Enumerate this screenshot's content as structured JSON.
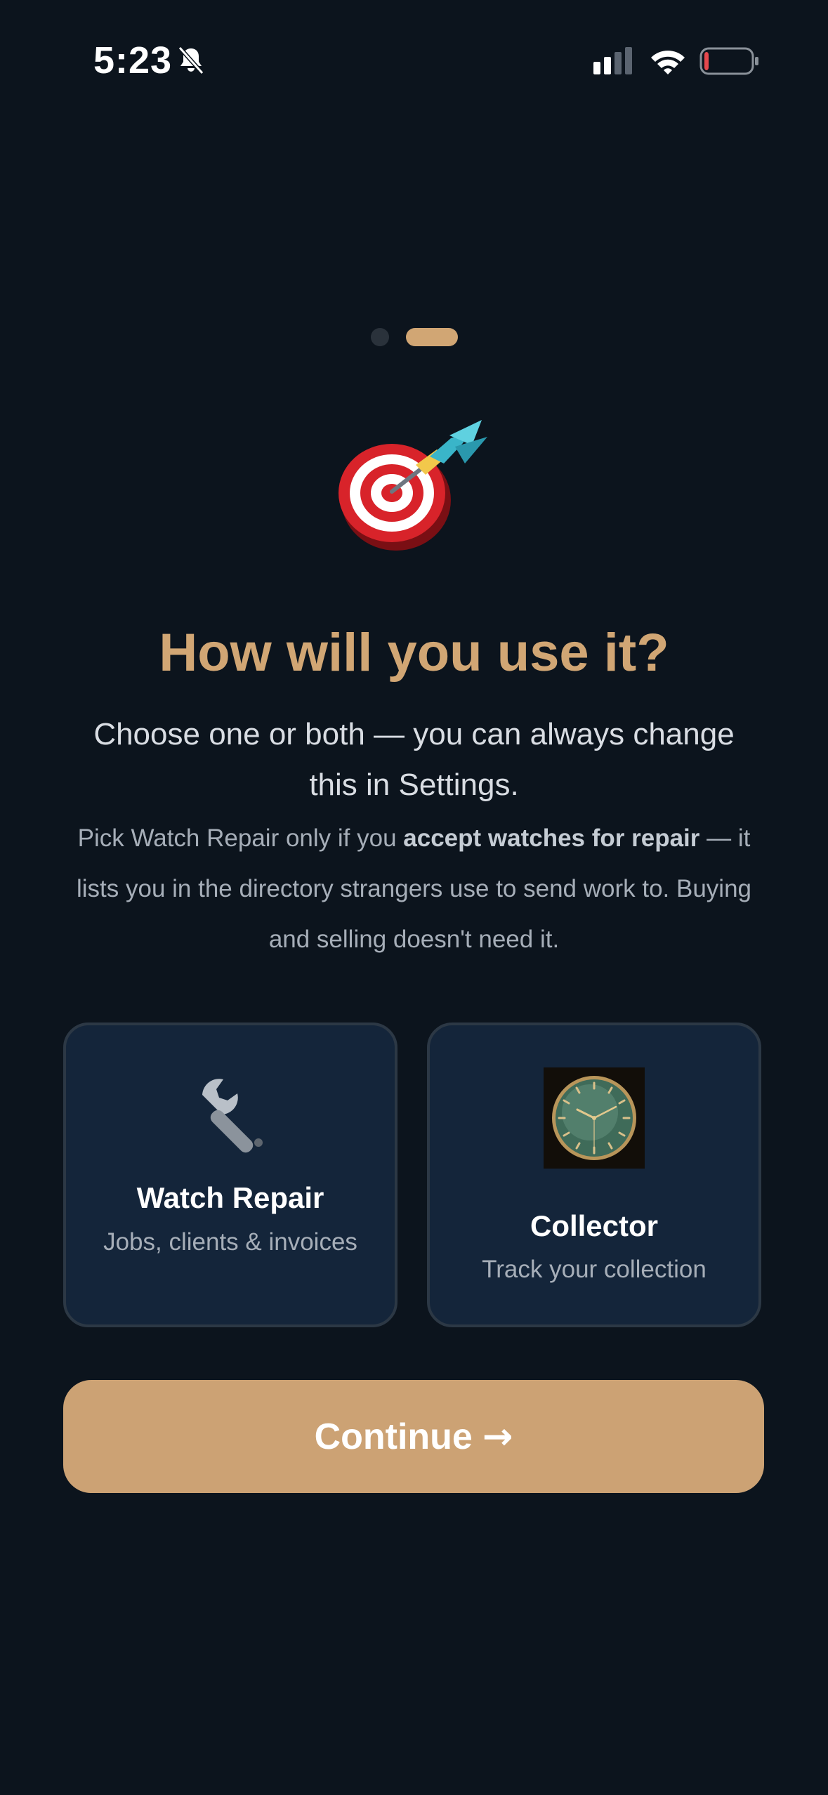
{
  "status_bar": {
    "time": "5:23",
    "icons": [
      "bell-slash-icon",
      "cellular-signal-icon",
      "wifi-icon",
      "battery-low-icon"
    ],
    "battery_level": 0.1,
    "battery_color": "#e5484d"
  },
  "pager": {
    "total_pages": 2,
    "current_page": 2,
    "active_color": "#d1a674"
  },
  "hero": {
    "icon": "dart-target-icon"
  },
  "title": "How will you use it?",
  "subtitle": "Choose one or both — you can always change this in Settings.",
  "note": {
    "prefix": "Pick Watch Repair only if you ",
    "emphasis": "accept watches for repair",
    "suffix": " — it lists you in the directory strangers use to send work to. Buying and selling doesn't need it."
  },
  "options": [
    {
      "icon": "wrench-icon",
      "title": "Watch Repair",
      "subtitle": "Jobs, clients & invoices"
    },
    {
      "icon": "watch-face-icon",
      "title": "Collector",
      "subtitle": "Track your collection"
    }
  ],
  "continue_button": {
    "label": "Continue",
    "icon": "arrow-right-icon",
    "arrow": "→"
  },
  "colors": {
    "background": "#0c141d",
    "accent": "#d1a674",
    "card_background": "#14253a",
    "card_border": "#2c3845"
  }
}
